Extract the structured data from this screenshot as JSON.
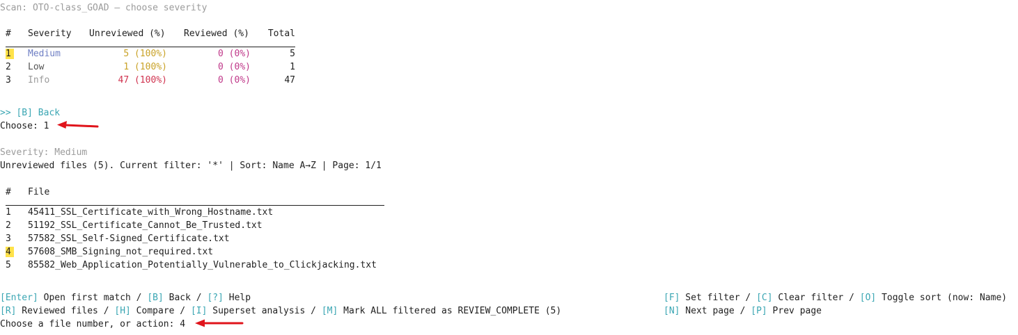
{
  "header": {
    "scan_title": "Scan: OTO-class_GOAD — choose severity"
  },
  "severity_table": {
    "columns": [
      "#",
      "Severity",
      "Unreviewed (%)",
      "Reviewed (%)",
      "Total"
    ],
    "rows": [
      {
        "num": "1",
        "severity": "Medium",
        "unreviewed": "5 (100%)",
        "reviewed": "0 (0%)",
        "total": "5",
        "severity_color": "#6f7fc4",
        "unreviewed_color": "#c9a227"
      },
      {
        "num": "2",
        "severity": "Low",
        "unreviewed": "1 (100%)",
        "reviewed": "0 (0%)",
        "total": "1",
        "severity_color": "#555555",
        "unreviewed_color": "#c9a227"
      },
      {
        "num": "3",
        "severity": "Info",
        "unreviewed": "47 (100%)",
        "reviewed": "0 (0%)",
        "total": "47",
        "severity_color": "#9b9b9b",
        "unreviewed_color": "#d0334f"
      }
    ],
    "reviewed_color": "#c0398a"
  },
  "back_option": ">> [B] Back",
  "prompt1": {
    "text": "Choose: 1"
  },
  "severity_label": "Severity: Medium",
  "files_status": "Unreviewed files (5). Current filter: '*' | Sort: Name A→Z | Page: 1/1",
  "files_table": {
    "columns": [
      "#",
      "File"
    ],
    "rows": [
      {
        "num": "1",
        "file": "45411_SSL_Certificate_with_Wrong_Hostname.txt"
      },
      {
        "num": "2",
        "file": "51192_SSL_Certificate_Cannot_Be_Trusted.txt"
      },
      {
        "num": "3",
        "file": "57582_SSL_Self-Signed_Certificate.txt"
      },
      {
        "num": "4",
        "file": "57608_SMB_Signing_not_required.txt"
      },
      {
        "num": "5",
        "file": "85582_Web_Application_Potentially_Vulnerable_to_Clickjacking.txt"
      }
    ]
  },
  "actions": {
    "row1_left": [
      {
        "key": "[Enter]",
        "label": " Open first match"
      },
      {
        "key": "[B]",
        "label": " Back"
      },
      {
        "key": "[?]",
        "label": " Help"
      }
    ],
    "row2_left": [
      {
        "key": "[R]",
        "label": " Reviewed files"
      },
      {
        "key": "[H]",
        "label": " Compare"
      },
      {
        "key": "[I]",
        "label": " Superset analysis"
      },
      {
        "key": "[M]",
        "label": " Mark ALL filtered as REVIEW_COMPLETE (5)"
      }
    ],
    "row1_right": [
      {
        "key": "[F]",
        "label": " Set filter"
      },
      {
        "key": "[C]",
        "label": " Clear filter"
      },
      {
        "key": "[O]",
        "label": " Toggle sort (now: Name)"
      }
    ],
    "row2_right": [
      {
        "key": "[N]",
        "label": " Next page"
      },
      {
        "key": "[P]",
        "label": " Prev page"
      }
    ],
    "separator": " / "
  },
  "prompt2": {
    "text": "Choose a file number, or action: 4"
  },
  "colors": {
    "highlight": "#ffe24a",
    "arrow": "#e0141b",
    "key_color": "#3aa6b3"
  },
  "icons": [
    "red-arrow-icon"
  ]
}
